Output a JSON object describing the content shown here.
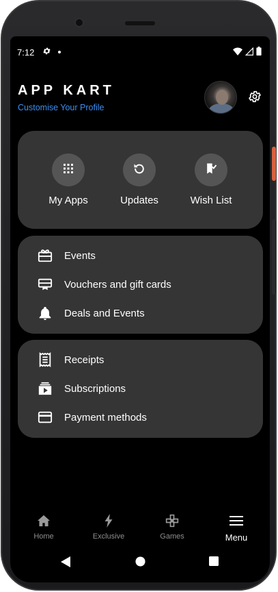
{
  "status_bar": {
    "time": "7:12"
  },
  "header": {
    "app_title": "APP KART",
    "subtitle": "Customise Your Profile"
  },
  "quick_actions": [
    {
      "label": "My Apps",
      "icon": "apps-grid-icon"
    },
    {
      "label": "Updates",
      "icon": "refresh-icon"
    },
    {
      "label": "Wish List",
      "icon": "bookmark-check-icon"
    }
  ],
  "section_offers": [
    {
      "label": "Events",
      "icon": "gift-icon"
    },
    {
      "label": "Vouchers and gift cards",
      "icon": "voucher-icon"
    },
    {
      "label": "Deals and Events",
      "icon": "bell-icon"
    }
  ],
  "section_payments": [
    {
      "label": "Receipts",
      "icon": "receipt-icon"
    },
    {
      "label": "Subscriptions",
      "icon": "subscriptions-icon"
    },
    {
      "label": "Payment methods",
      "icon": "credit-card-icon"
    }
  ],
  "bottom_nav": {
    "items": [
      {
        "label": "Home",
        "icon": "home-icon"
      },
      {
        "label": "Exclusive",
        "icon": "lightning-icon"
      },
      {
        "label": "Games",
        "icon": "gamepad-icon"
      },
      {
        "label": "Menu",
        "icon": "menu-icon"
      }
    ],
    "active": "Menu"
  },
  "colors": {
    "background": "#000000",
    "card": "#353535",
    "accent": "#3d8ef0",
    "inactive_nav": "#8e8e8e"
  }
}
